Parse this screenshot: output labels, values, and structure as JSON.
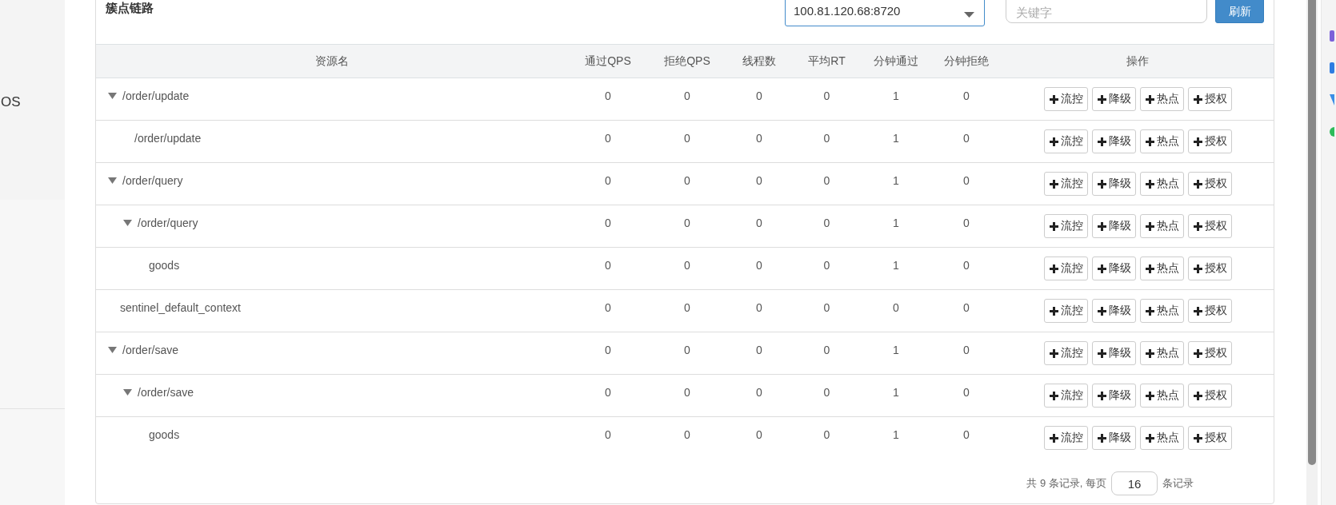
{
  "sidebar": {
    "item": "OS"
  },
  "panel": {
    "title": "簇点链路",
    "machine_select": {
      "value": "100.81.120.68:8720"
    },
    "search": {
      "placeholder": "关键字"
    },
    "refresh_button": "刷新"
  },
  "table": {
    "columns": [
      "资源名",
      "通过QPS",
      "拒绝QPS",
      "线程数",
      "平均RT",
      "分钟通过",
      "分钟拒绝",
      "操作"
    ],
    "rows": [
      {
        "name": "/order/update",
        "expanded": true,
        "values": [
          "0",
          "0",
          "0",
          "0",
          "1",
          "0"
        ],
        "actions": [
          "流控",
          "降级",
          "热点",
          "授权"
        ],
        "children": [
          {
            "name": "/order/update",
            "values": [
              "0",
              "0",
              "0",
              "0",
              "1",
              "0"
            ],
            "actions": [
              "流控",
              "降级",
              "热点",
              "授权"
            ]
          }
        ]
      },
      {
        "name": "/order/query",
        "expanded": true,
        "values": [
          "0",
          "0",
          "0",
          "0",
          "1",
          "0"
        ],
        "actions": [
          "流控",
          "降级",
          "热点",
          "授权"
        ],
        "children": [
          {
            "name": "/order/query",
            "expanded": true,
            "values": [
              "0",
              "0",
              "0",
              "0",
              "1",
              "0"
            ],
            "actions": [
              "流控",
              "降级",
              "热点",
              "授权"
            ],
            "children": [
              {
                "name": "goods",
                "values": [
                  "0",
                  "0",
                  "0",
                  "0",
                  "1",
                  "0"
                ],
                "actions": [
                  "流控",
                  "降级",
                  "热点",
                  "授权"
                ]
              }
            ]
          }
        ]
      },
      {
        "name": "sentinel_default_context",
        "values": [
          "0",
          "0",
          "0",
          "0",
          "0",
          "0"
        ],
        "actions": [
          "流控",
          "降级",
          "热点",
          "授权"
        ]
      },
      {
        "name": "/order/save",
        "expanded": true,
        "values": [
          "0",
          "0",
          "0",
          "0",
          "1",
          "0"
        ],
        "actions": [
          "流控",
          "降级",
          "热点",
          "授权"
        ],
        "children": [
          {
            "name": "/order/save",
            "expanded": true,
            "values": [
              "0",
              "0",
              "0",
              "0",
              "1",
              "0"
            ],
            "actions": [
              "流控",
              "降级",
              "热点",
              "授权"
            ],
            "children": [
              {
                "name": "goods",
                "values": [
                  "0",
                  "0",
                  "0",
                  "0",
                  "1",
                  "0"
                ],
                "actions": [
                  "流控",
                  "降级",
                  "热点",
                  "授权"
                ]
              }
            ]
          }
        ]
      }
    ]
  },
  "pagination": {
    "total_text": "共 9 条记录, 每页",
    "page_size": "16",
    "suffix": "条记录"
  }
}
